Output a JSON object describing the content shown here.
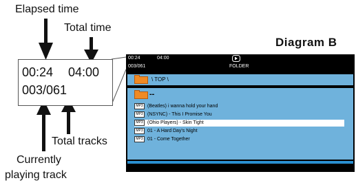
{
  "diagram": {
    "title": "Diagram B",
    "labels": {
      "elapsed_time": "Elapsed time",
      "total_time": "Total time",
      "total_tracks": "Total tracks",
      "currently_playing_line1": "Currently",
      "currently_playing_line2": "playing track"
    },
    "callout": {
      "elapsed": "00:24",
      "total": "04:00",
      "track_counter": "003/061"
    }
  },
  "screen": {
    "elapsed": "00:24",
    "total": "04:00",
    "track_counter": "003/061",
    "mode_label": "FOLDER",
    "path": "\\ TOP \\",
    "parent_label": "--",
    "file_icon_label": "MP3",
    "tracks": [
      "(Beatles) i wanna hold your hand",
      "(NSYNC) - This I Promise You",
      "(Ohio Players) - Skin Tight",
      "01 - A Hard Day's Night",
      "01 - Come Together"
    ],
    "selected_index": 2,
    "colors": {
      "background": "#000000",
      "panel": "#6fb2dc",
      "folder": "#f08a24",
      "highlight": "#ffffff"
    }
  }
}
